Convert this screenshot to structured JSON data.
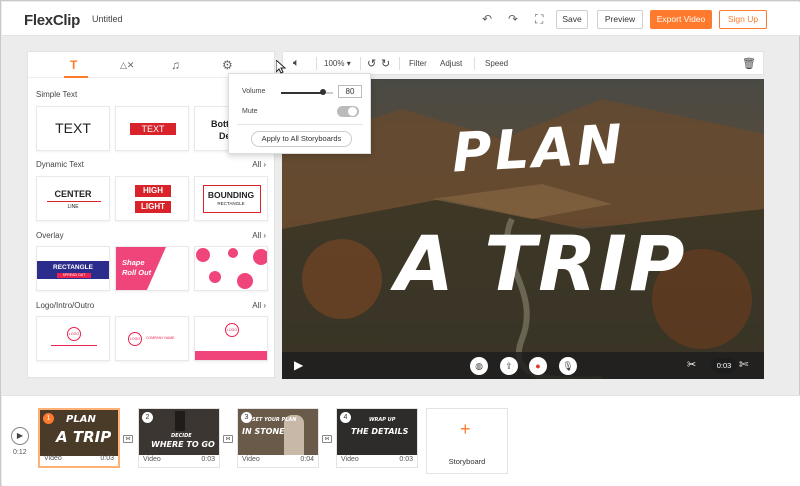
{
  "app": {
    "logo": "FlexClip",
    "doc_title": "Untitled"
  },
  "header": {
    "save": "Save",
    "preview": "Preview",
    "export": "Export Video",
    "signup": "Sign Up"
  },
  "library": {
    "sections": [
      {
        "title": "Simple Text",
        "all": ""
      },
      {
        "title": "Dynamic Text",
        "all": "All"
      },
      {
        "title": "Overlay",
        "all": "All"
      },
      {
        "title": "Logo/Intro/Outro",
        "all": "All"
      }
    ],
    "simple": [
      "TEXT",
      "TEXT",
      "Bott",
      "De"
    ],
    "dynamic": [
      "CENTER",
      "LINE",
      "HIGH",
      "LIGHT",
      "BOUNDING",
      "RECTANGLE"
    ],
    "overlay": [
      "RECTANGLE",
      "SPREAD OUT",
      "Shape",
      "Roll Out"
    ],
    "logo": [
      "LOGO",
      "COMPANY NAME"
    ]
  },
  "volume_popup": {
    "volume_label": "Volume",
    "volume_value": "80",
    "volume_level": 0.8,
    "mute_label": "Mute",
    "apply_button": "Apply to All Storyboards"
  },
  "canvas_toolbar": {
    "zoom": "100%",
    "filter": "Filter",
    "adjust": "Adjust",
    "speed": "Speed"
  },
  "video": {
    "line1": "PLAN",
    "line2": "A TRIP",
    "time": "0:03"
  },
  "timeline": {
    "total_time": "0:12",
    "clips": [
      {
        "num": "1",
        "label": "Video",
        "time": "0:03",
        "t1": "PLAN",
        "t2": "A TRIP"
      },
      {
        "num": "2",
        "label": "Video",
        "time": "0:03",
        "t1": "DECIDE",
        "t2": "WHERE TO GO"
      },
      {
        "num": "3",
        "label": "Video",
        "time": "0:04",
        "t1": "SET YOUR PLAN",
        "t2": "IN STONE"
      },
      {
        "num": "4",
        "label": "Video",
        "time": "0:03",
        "t1": "WRAP UP",
        "t2": "THE DETAILS"
      }
    ],
    "storyboard_label": "Storyboard"
  },
  "colors": {
    "accent": "#ff7a2c"
  }
}
